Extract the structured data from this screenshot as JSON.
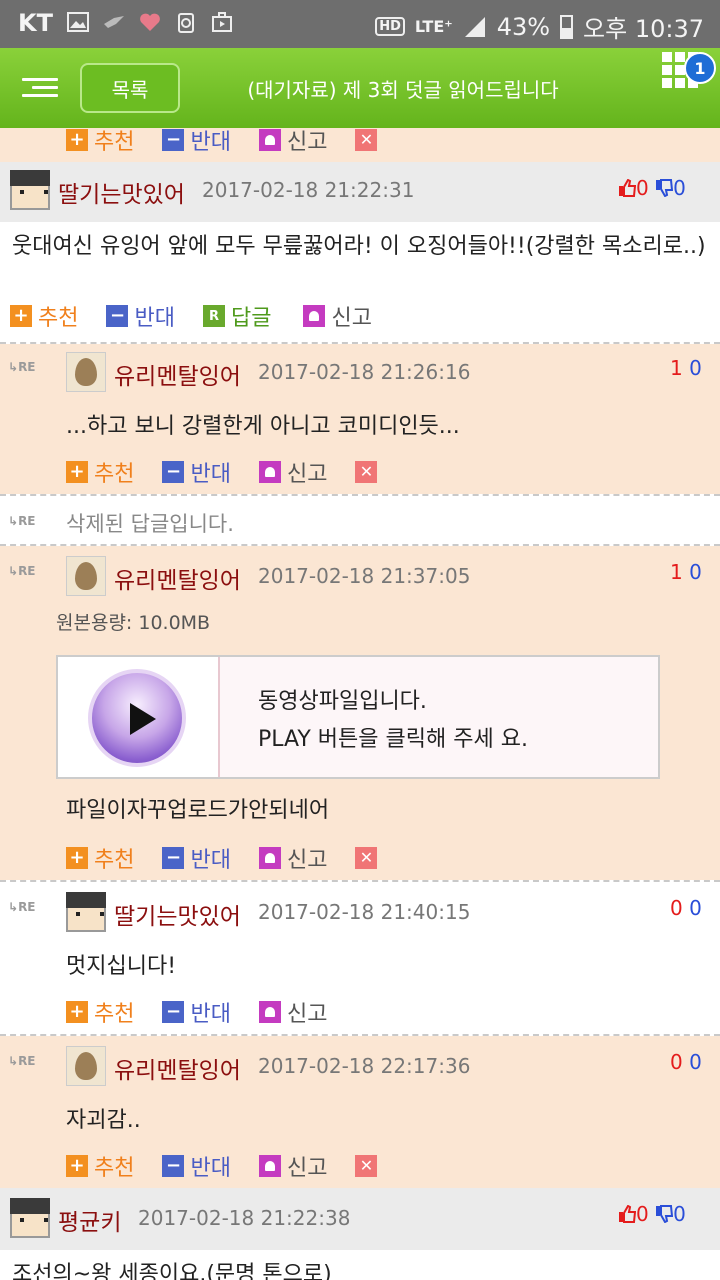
{
  "status_bar": {
    "carrier": "KT",
    "network": "LTE⁺",
    "hd": "HD",
    "battery": "43%",
    "time": "오후 10:37"
  },
  "header": {
    "list_button": "목록",
    "title": "(대기자료) 제 3회 덧글 읽어드립니다",
    "badge": "1"
  },
  "actions": {
    "recommend": "추천",
    "oppose": "반대",
    "reply": "답글",
    "report": "신고"
  },
  "deleted_reply": "삭제된 답글입니다.",
  "comments": [
    {
      "nick": "딸기는맛있어",
      "date": "2017-02-18 21:22:31",
      "up": "0",
      "down": "0",
      "text": "웃대여신 유잉어 앞에 모두 무릎꿇어라! 이 오징어들아!!(강렬한 목소리로..)"
    },
    {
      "nick": "유리멘탈잉어",
      "date": "2017-02-18 21:26:16",
      "up": "1",
      "down": "0",
      "text": "...하고 보니 강렬한게 아니고 코미디인듯..."
    },
    {
      "nick": "유리멘탈잉어",
      "date": "2017-02-18 21:37:05",
      "up": "1",
      "down": "0",
      "original_size": "원본용량: 10.0MB",
      "video_line1": "동영상파일입니다.",
      "video_line2": "PLAY 버튼을  클릭해 주세 요.",
      "text": "파일이자꾸업로드가안되네어"
    },
    {
      "nick": "딸기는맛있어",
      "date": "2017-02-18 21:40:15",
      "up": "0",
      "down": "0",
      "text": "멋지십니다!"
    },
    {
      "nick": "유리멘탈잉어",
      "date": "2017-02-18 22:17:36",
      "up": "0",
      "down": "0",
      "text": "자괴감.."
    },
    {
      "nick": "평균키",
      "date": "2017-02-18 21:22:38",
      "up": "0",
      "down": "0",
      "text": "조선의~왕 세종이요.(문명 톤으로)"
    }
  ],
  "re_label": "RE"
}
